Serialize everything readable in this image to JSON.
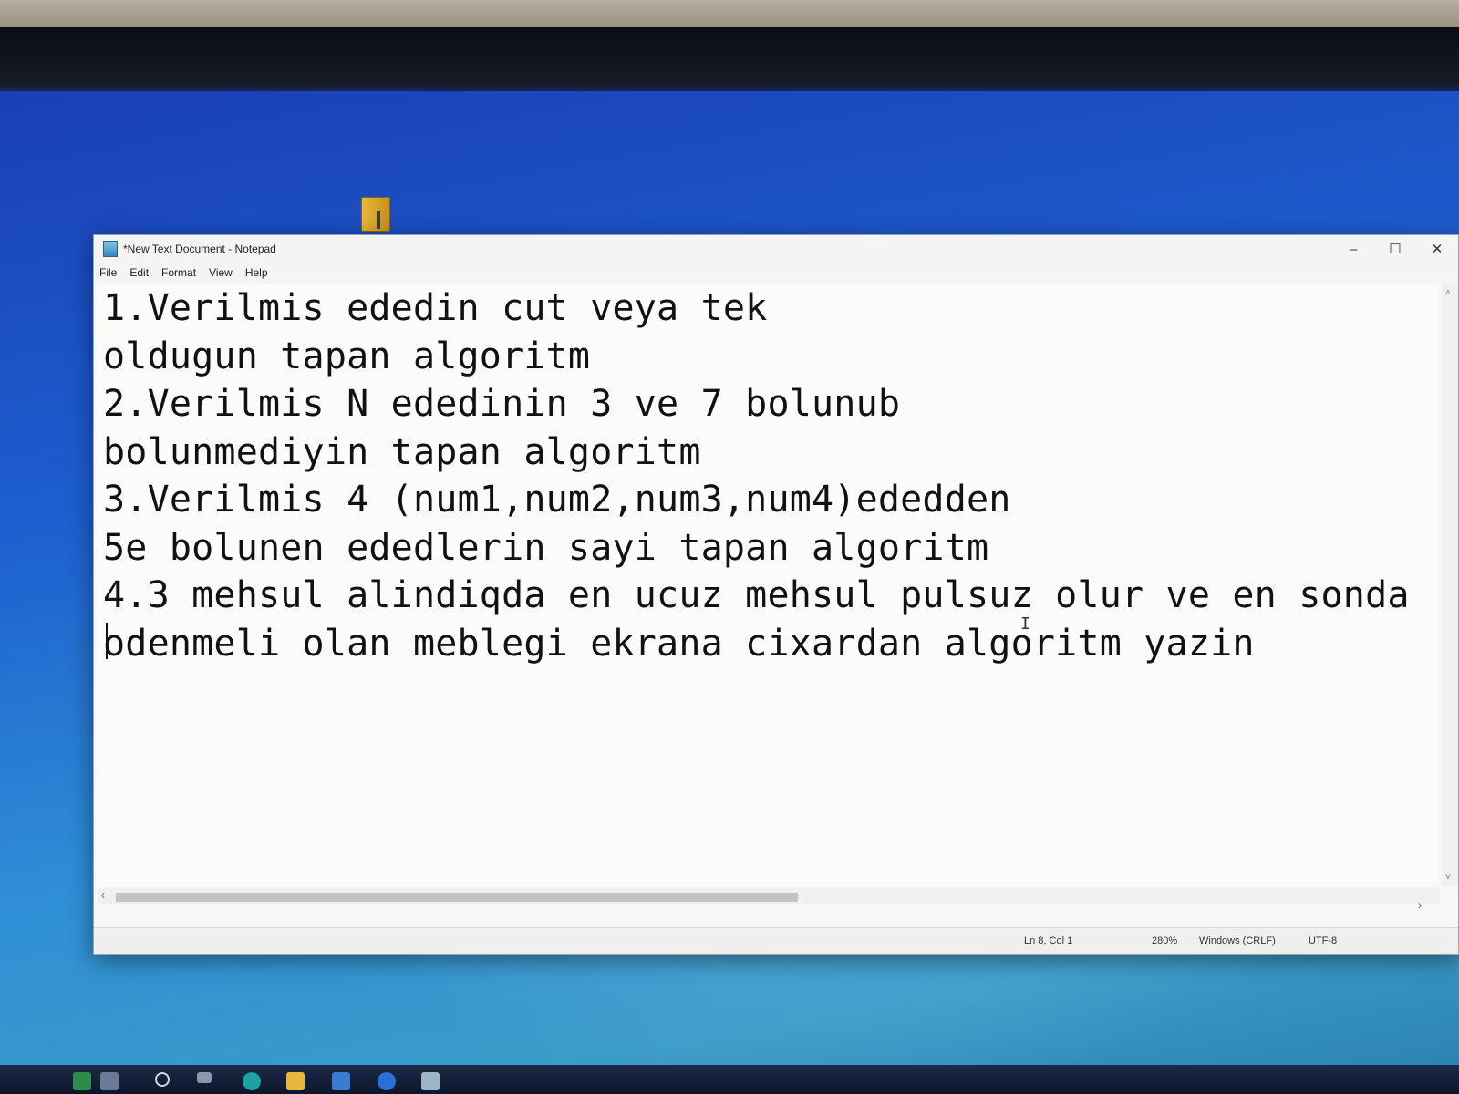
{
  "window": {
    "title": "*New Text Document - Notepad",
    "controls": {
      "minimize": "–",
      "maximize": "☐",
      "close": "✕"
    }
  },
  "menu": [
    "File",
    "Edit",
    "Format",
    "View",
    "Help"
  ],
  "editor": {
    "lines": [
      "1.Verilmis ededin cut veya tek",
      "oldugun tapan algoritm",
      "2.Verilmis N ededinin 3 ve 7 bolunub",
      "bolunmediyin tapan algoritm",
      "3.Verilmis 4 (num1,num2,num3,num4)ededden",
      "5e bolunen ededlerin sayi tapan algoritm",
      "4.3 mehsul alindiqda en ucuz mehsul pulsuz olur ve en sonda",
      "odenmeli olan meblegi ekrana cixardan algoritm yazin"
    ]
  },
  "status": {
    "position": "Ln 8, Col 1",
    "zoom": "280%",
    "line_ending": "Windows (CRLF)",
    "encoding": "UTF-8"
  },
  "icons": {
    "app": "notepad-icon",
    "desktop_item": "folder-icon",
    "scroll_left": "‹",
    "scroll_right": "›",
    "scroll_up": "˄",
    "scroll_down": "˅"
  }
}
